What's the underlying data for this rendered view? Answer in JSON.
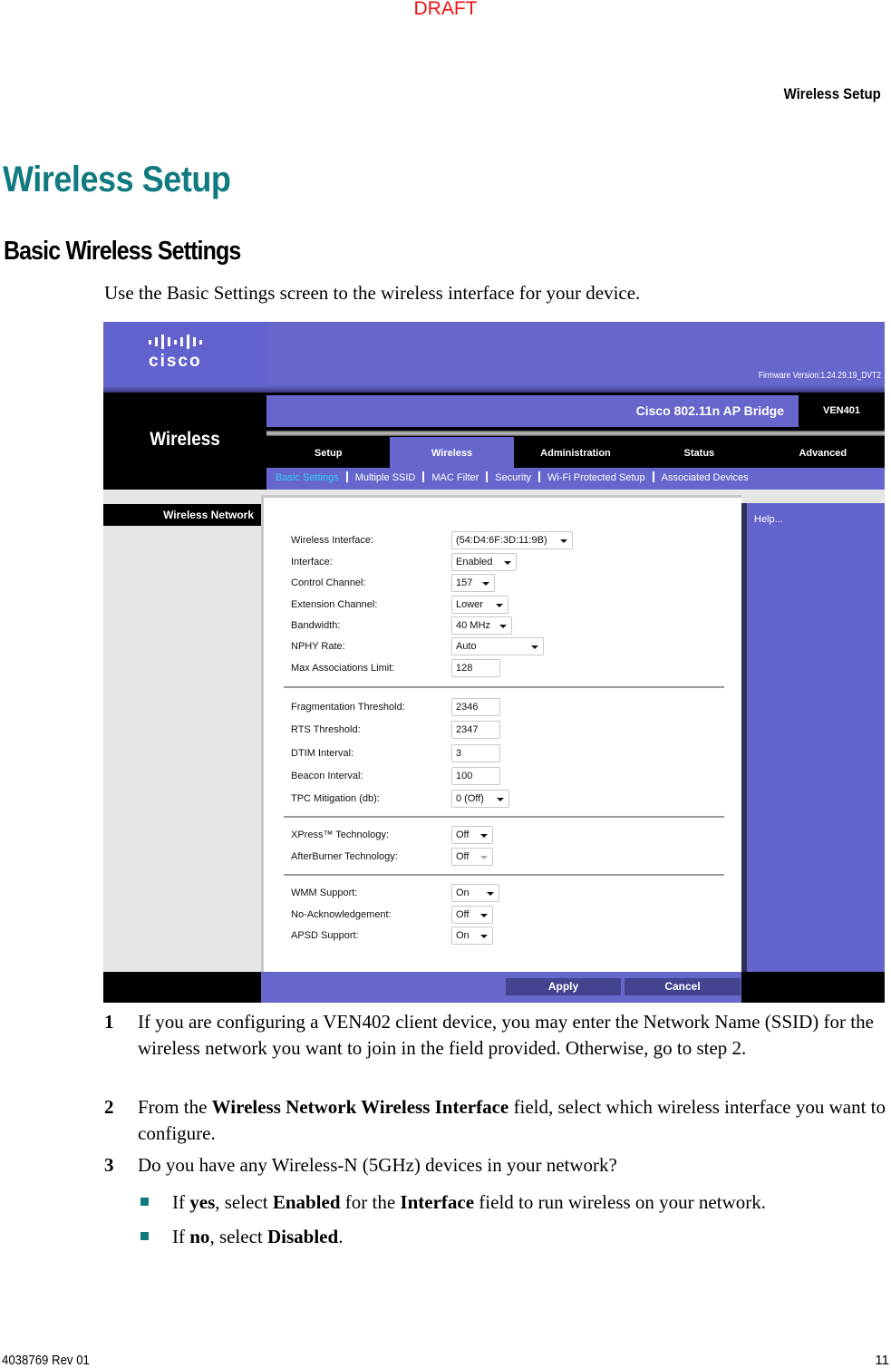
{
  "watermark": "DRAFT",
  "running_head": "Wireless Setup",
  "chapter_title": "Wireless Setup",
  "section_title": "Basic Wireless Settings",
  "intro": "Use the Basic Settings screen to the wireless interface for your device.",
  "ui": {
    "brand": "cisco",
    "firmware": "Firmware Version:1.24.29.19_DVT2",
    "section": "Wireless",
    "product_name": "Cisco 802.11n AP Bridge",
    "model": "VEN401",
    "colors": {
      "primary": "#6666cc",
      "active_subnav": "#33ccff",
      "button": "#434390"
    },
    "tabs": [
      {
        "label": "Setup",
        "active": false
      },
      {
        "label": "Wireless",
        "active": true
      },
      {
        "label": "Administration",
        "active": false
      },
      {
        "label": "Status",
        "active": false
      },
      {
        "label": "Advanced",
        "active": false
      }
    ],
    "subnav": [
      {
        "label": "Basic Settings",
        "active": true
      },
      {
        "label": "Multiple SSID",
        "active": false
      },
      {
        "label": "MAC Filter",
        "active": false
      },
      {
        "label": "Security",
        "active": false
      },
      {
        "label": "Wi-Fi Protected Setup",
        "active": false
      },
      {
        "label": "Associated Devices",
        "active": false
      }
    ],
    "side_title": "Wireless Network",
    "help_text": "Help...",
    "fields": [
      {
        "label": "Wireless Interface:",
        "value": "(54:D4:6F:3D:11:9B)",
        "type": "select"
      },
      {
        "label": "Interface:",
        "value": "Enabled",
        "type": "select"
      },
      {
        "label": "Control Channel:",
        "value": "157",
        "type": "select"
      },
      {
        "label": "Extension Channel:",
        "value": "Lower",
        "type": "select"
      },
      {
        "label": "Bandwidth:",
        "value": "40 MHz",
        "type": "select"
      },
      {
        "label": "NPHY Rate:",
        "value": "Auto",
        "type": "select"
      },
      {
        "label": "Max Associations Limit:",
        "value": "128",
        "type": "text"
      },
      {
        "label": "Fragmentation Threshold:",
        "value": "2346",
        "type": "text"
      },
      {
        "label": "RTS Threshold:",
        "value": "2347",
        "type": "text"
      },
      {
        "label": "DTIM Interval:",
        "value": "3",
        "type": "text"
      },
      {
        "label": "Beacon Interval:",
        "value": "100",
        "type": "text"
      },
      {
        "label": "TPC Mitigation (db):",
        "value": "0 (Off)",
        "type": "select"
      },
      {
        "label": "XPress™ Technology:",
        "value": "Off",
        "type": "select"
      },
      {
        "label": "AfterBurner Technology:",
        "value": "Off",
        "type": "select",
        "disabled": true
      },
      {
        "label": "WMM Support:",
        "value": "On",
        "type": "select"
      },
      {
        "label": "No-Acknowledgement:",
        "value": "Off",
        "type": "select"
      },
      {
        "label": "APSD Support:",
        "value": "On",
        "type": "select"
      }
    ],
    "apply_label": "Apply",
    "cancel_label": "Cancel"
  },
  "steps": [
    {
      "num": "1",
      "text": "If you are configuring a VEN402 client device, you may enter the Network Name (SSID) for the wireless network you want to join in the field provided. Otherwise, go to step 2."
    },
    {
      "num": "2",
      "pre": "From the ",
      "bold": "Wireless Network Wireless Interface",
      "post": " field, select which wireless interface you want to configure."
    },
    {
      "num": "3",
      "text": "Do you have any Wireless-N (5GHz) devices in your network?"
    }
  ],
  "bullets": [
    {
      "parts": [
        "If ",
        "yes",
        ", select ",
        "Enabled",
        " for the ",
        "Interface",
        " field to run wireless on your network."
      ]
    },
    {
      "parts": [
        "If ",
        "no",
        ", select ",
        "Disabled",
        "."
      ]
    }
  ],
  "footer": {
    "doc_id": "4038769 Rev 01",
    "page": "11"
  }
}
